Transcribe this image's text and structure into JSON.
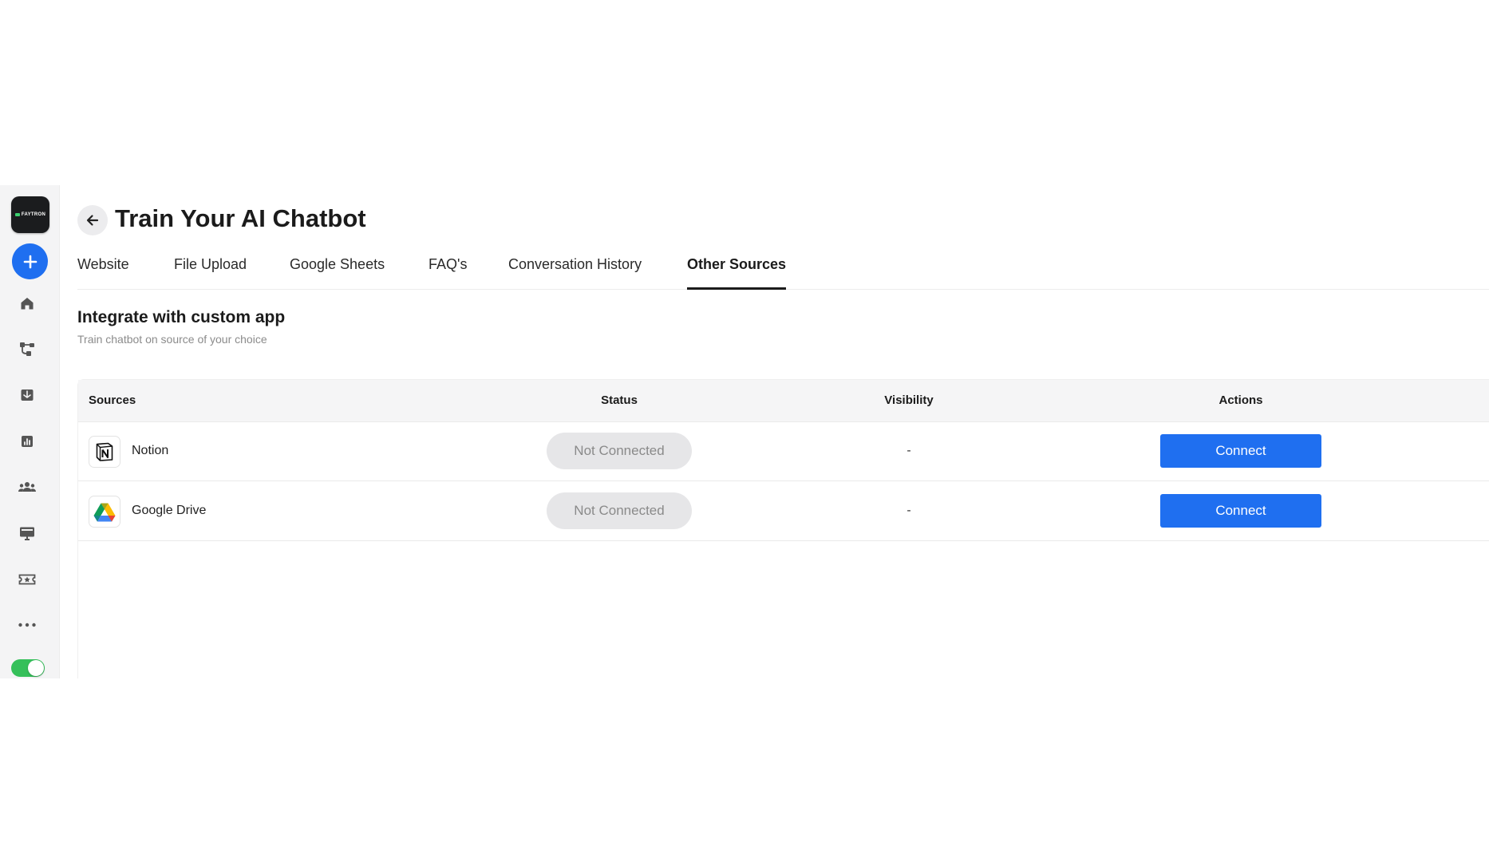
{
  "app": {
    "logo_text": "FAYTRON",
    "toggle_on": true
  },
  "sidebar": {
    "items": [
      {
        "name": "home",
        "icon": "home-icon"
      },
      {
        "name": "flows",
        "icon": "flow-icon"
      },
      {
        "name": "inbox",
        "icon": "inbox-icon"
      },
      {
        "name": "analytics",
        "icon": "chart-icon"
      },
      {
        "name": "team",
        "icon": "team-icon"
      },
      {
        "name": "training",
        "icon": "monitor-icon"
      },
      {
        "name": "tickets",
        "icon": "ticket-icon"
      },
      {
        "name": "more",
        "icon": "more-icon"
      }
    ]
  },
  "header": {
    "title": "Train Your AI Chatbot"
  },
  "tabs": [
    {
      "label": "Website",
      "active": false
    },
    {
      "label": "File Upload",
      "active": false
    },
    {
      "label": "Google Sheets",
      "active": false
    },
    {
      "label": "FAQ's",
      "active": false
    },
    {
      "label": "Conversation History",
      "active": false
    },
    {
      "label": "Other Sources",
      "active": true
    }
  ],
  "section": {
    "title": "Integrate with custom app",
    "subtitle": "Train chatbot on source of your choice"
  },
  "table": {
    "columns": [
      "Sources",
      "Status",
      "Visibility",
      "Actions"
    ],
    "rows": [
      {
        "source": "Notion",
        "icon": "notion-icon",
        "status": "Not Connected",
        "visibility": "-",
        "action": "Connect"
      },
      {
        "source": "Google Drive",
        "icon": "google-drive-icon",
        "status": "Not Connected",
        "visibility": "-",
        "action": "Connect"
      }
    ]
  },
  "colors": {
    "accent": "#1f6ff0",
    "toggle_on": "#35c05a",
    "status_pill_bg": "#e6e6e8",
    "status_pill_text": "#8a8a8a"
  }
}
